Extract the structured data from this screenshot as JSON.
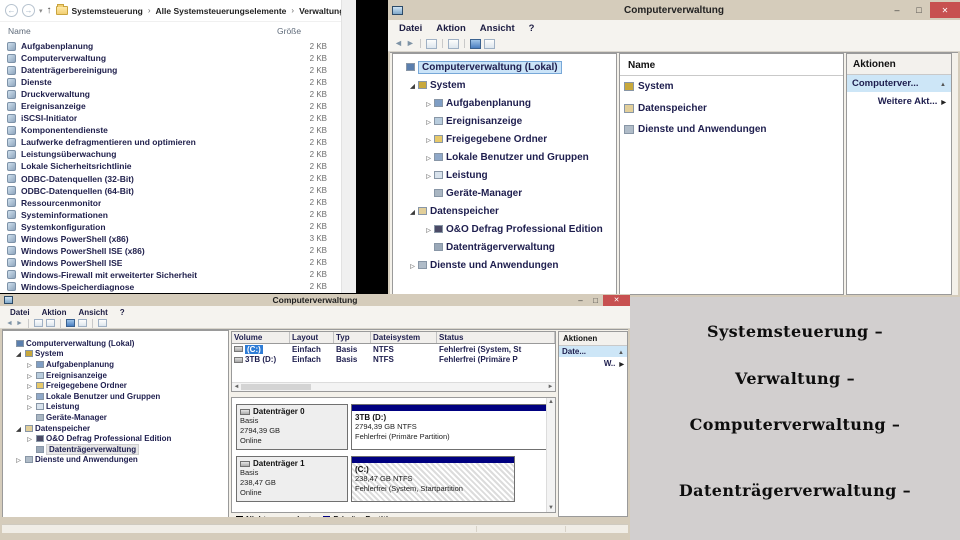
{
  "page": {
    "bg_top": "#000000",
    "caption_panel_bg": "#d2cfcf",
    "titlebar_color": "#d5ccbb",
    "accent_navy": "#000080",
    "selection_blue": "#2e7cd6"
  },
  "explorer": {
    "breadcrumb": {
      "items": [
        "Systemsteuerung",
        "Alle Systemsteuerungselemente",
        "Verwaltung"
      ],
      "separator": "›"
    },
    "columns": {
      "name": "Name",
      "size": "Größe"
    },
    "items": [
      {
        "label": "Aufgabenplanung",
        "size": "2 KB"
      },
      {
        "label": "Computerverwaltung",
        "size": "2 KB"
      },
      {
        "label": "Datenträgerbereinigung",
        "size": "2 KB"
      },
      {
        "label": "Dienste",
        "size": "2 KB"
      },
      {
        "label": "Druckverwaltung",
        "size": "2 KB"
      },
      {
        "label": "Ereignisanzeige",
        "size": "2 KB"
      },
      {
        "label": "iSCSI-Initiator",
        "size": "2 KB"
      },
      {
        "label": "Komponentendienste",
        "size": "2 KB"
      },
      {
        "label": "Laufwerke defragmentieren und optimieren",
        "size": "2 KB"
      },
      {
        "label": "Leistungsüberwachung",
        "size": "2 KB"
      },
      {
        "label": "Lokale Sicherheitsrichtlinie",
        "size": "2 KB"
      },
      {
        "label": "ODBC-Datenquellen (32-Bit)",
        "size": "2 KB"
      },
      {
        "label": "ODBC-Datenquellen (64-Bit)",
        "size": "2 KB"
      },
      {
        "label": "Ressourcenmonitor",
        "size": "2 KB"
      },
      {
        "label": "Systeminformationen",
        "size": "2 KB"
      },
      {
        "label": "Systemkonfiguration",
        "size": "2 KB"
      },
      {
        "label": "Windows PowerShell (x86)",
        "size": "3 KB"
      },
      {
        "label": "Windows PowerShell ISE (x86)",
        "size": "2 KB"
      },
      {
        "label": "Windows PowerShell ISE",
        "size": "2 KB"
      },
      {
        "label": "Windows-Firewall mit erweiterter Sicherheit",
        "size": "2 KB"
      },
      {
        "label": "Windows-Speicherdiagnose",
        "size": "2 KB"
      }
    ]
  },
  "mmc_tree": [
    {
      "label": "Computerverwaltung (Lokal)",
      "level": 0,
      "exp": "none",
      "icon": "computer-icon"
    },
    {
      "label": "System",
      "level": 1,
      "exp": "open",
      "icon": "system-icon"
    },
    {
      "label": "Aufgabenplanung",
      "level": 2,
      "exp": "closed",
      "icon": "task-scheduler-icon"
    },
    {
      "label": "Ereignisanzeige",
      "level": 2,
      "exp": "closed",
      "icon": "event-viewer-icon"
    },
    {
      "label": "Freigegebene Ordner",
      "level": 2,
      "exp": "closed",
      "icon": "shared-folders-icon"
    },
    {
      "label": "Lokale Benutzer und Gruppen",
      "level": 2,
      "exp": "closed",
      "icon": "users-icon"
    },
    {
      "label": "Leistung",
      "level": 2,
      "exp": "closed",
      "icon": "performance-icon"
    },
    {
      "label": "Geräte-Manager",
      "level": 2,
      "exp": "none",
      "icon": "device-manager-icon"
    },
    {
      "label": "Datenspeicher",
      "level": 1,
      "exp": "open",
      "icon": "storage-icon"
    },
    {
      "label": "O&O Defrag Professional Edition",
      "level": 2,
      "exp": "closed",
      "icon": "defrag-icon"
    },
    {
      "label": "Datenträgerverwaltung",
      "level": 2,
      "exp": "none",
      "icon": "disk-management-icon"
    },
    {
      "label": "Dienste und Anwendungen",
      "level": 1,
      "exp": "closed",
      "icon": "services-icon"
    }
  ],
  "window_top": {
    "title": "Computerverwaltung",
    "menu": [
      "Datei",
      "Aktion",
      "Ansicht",
      "?"
    ],
    "selected_tree_item": "Computerverwaltung (Lokal)",
    "list": {
      "header": "Name",
      "items": [
        "System",
        "Datenspeicher",
        "Dienste und Anwendungen"
      ]
    },
    "actions": {
      "header": "Aktionen",
      "primary": "Computerver...",
      "secondary": "Weitere Akt..."
    }
  },
  "window_bottom": {
    "title": "Computerverwaltung",
    "menu": [
      "Datei",
      "Aktion",
      "Ansicht",
      "?"
    ],
    "selected_tree_item": "Datenträgerverwaltung",
    "volume_table": {
      "columns": [
        "Volume",
        "Layout",
        "Typ",
        "Dateisystem",
        "Status"
      ],
      "rows": [
        {
          "volume": "(C:)",
          "layout": "Einfach",
          "typ": "Basis",
          "dateisystem": "NTFS",
          "status": "Fehlerfrei (System, St",
          "selected": true
        },
        {
          "volume": "3TB (D:)",
          "layout": "Einfach",
          "typ": "Basis",
          "dateisystem": "NTFS",
          "status": "Fehlerfrei (Primäre P",
          "selected": false
        }
      ]
    },
    "disks": [
      {
        "name": "Datenträger 0",
        "kind": "Basis",
        "size": "2794,39 GB",
        "state": "Online",
        "partition": {
          "title": "3TB (D:)",
          "line2": "2794,39 GB NTFS",
          "line3": "Fehlerfrei (Primäre Partition)",
          "selected": false,
          "width_pct": 100
        }
      },
      {
        "name": "Datenträger 1",
        "kind": "Basis",
        "size": "238,47 GB",
        "state": "Online",
        "partition": {
          "title": "(C:)",
          "line2": "238,47 GB NTFS",
          "line3": "Fehlerfrei (System, Startpartition",
          "selected": true,
          "width_pct": 83
        }
      }
    ],
    "legend": [
      {
        "label": "Nicht zugeordnet",
        "color": "#000000"
      },
      {
        "label": "Primäre Partition",
        "color": "#000080"
      }
    ],
    "actions": {
      "header": "Aktionen",
      "primary": "Date...",
      "secondary": "W.."
    }
  },
  "captions": [
    {
      "text": "Systemsteuerung –"
    },
    {
      "text": "Verwaltung –"
    },
    {
      "text": "Computerverwaltung –"
    },
    {
      "text": "Datenträgerverwaltung –"
    }
  ]
}
